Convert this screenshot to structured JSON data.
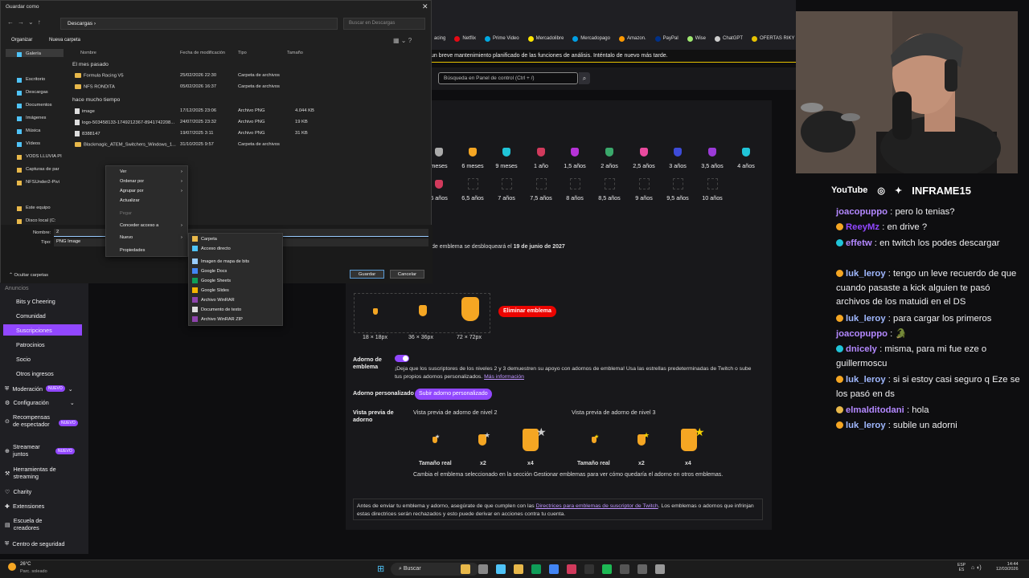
{
  "dialog": {
    "title": "Guardar como",
    "path": [
      "Descargas"
    ],
    "search_placeholder": "Buscar en Descargas",
    "organize": "Organizar",
    "new_folder": "Nueva carpeta",
    "nav_items": [
      "Galería",
      "Escritorio",
      "Descargas",
      "Documentos",
      "Imágenes",
      "Música",
      "Vídeos",
      "VODS LLUVIA PI",
      "Capturas de par",
      "NFSUnder2-Pivi",
      "Este equipo",
      "Disco local (C:"
    ],
    "columns": [
      "Nombre",
      "Fecha de modificación",
      "Tipo",
      "Tamaño"
    ],
    "groups": [
      {
        "label": "El mes pasado",
        "files": [
          {
            "name": "Formula Racing V5",
            "date": "25/02/2026 22:30",
            "type": "Carpeta de archivos",
            "size": "",
            "kind": "folder"
          },
          {
            "name": "NFS RONDITA",
            "date": "05/02/2026 16:37",
            "type": "Carpeta de archivos",
            "size": "",
            "kind": "folder"
          }
        ]
      },
      {
        "label": "hace mucho tiempo",
        "files": [
          {
            "name": "image",
            "date": "17/12/2025 23:06",
            "type": "Archivo PNG",
            "size": "4.044 KB",
            "kind": "file"
          },
          {
            "name": "logo-503458133-1749212367-8941742208...",
            "date": "24/07/2025 23:32",
            "type": "Archivo PNG",
            "size": "19 KB",
            "kind": "file"
          },
          {
            "name": "8388147",
            "date": "19/07/2025 3:11",
            "type": "Archivo PNG",
            "size": "31 KB",
            "kind": "file"
          },
          {
            "name": "Blackmagic_ATEM_Switchers_Windows_1...",
            "date": "31/10/2025 9:57",
            "type": "Carpeta de archivos",
            "size": "",
            "kind": "folder"
          }
        ]
      }
    ],
    "filename_label": "Nombre:",
    "filename_value": "2",
    "type_label": "Tipo:",
    "type_value": "PNG Image",
    "hide_folders": "Ocultar carpetas",
    "save": "Guardar",
    "cancel": "Cancelar"
  },
  "context_menu": [
    "Ver",
    "Ordenar por",
    "Agrupar por",
    "Actualizar",
    "Pegar",
    "Conceder acceso a",
    "Nuevo",
    "Propiedades"
  ],
  "submenu": [
    "Carpeta",
    "Acceso directo",
    "Imagen de mapa de bits",
    "Google Docs",
    "Google Sheets",
    "Google Slides",
    "Archivo WinRAR",
    "Documento de texto",
    "Archivo WinRAR ZIP"
  ],
  "bookmarks": [
    {
      "label": "acing",
      "color": "#888"
    },
    {
      "label": "Netflix",
      "color": "#e50914"
    },
    {
      "label": "Prime Video",
      "color": "#00a8e1"
    },
    {
      "label": "Mercadolibre",
      "color": "#ffe600"
    },
    {
      "label": "Mercadopago",
      "color": "#009ee3"
    },
    {
      "label": "Amazon.",
      "color": "#ff9900"
    },
    {
      "label": "PayPal",
      "color": "#003087"
    },
    {
      "label": "Wise",
      "color": "#9fe870"
    },
    {
      "label": "ChatGPT",
      "color": "#ccc"
    },
    {
      "label": "OFERTAS RIKY S",
      "color": "#e6c200"
    }
  ],
  "banner": "un breve mantenimiento planificado de las funciones de análisis. Inténtalo de nuevo más tarde.",
  "twitch_search_placeholder": "Búsqueda en Panel de control (Ctrl + /)",
  "sidebar": [
    "Anuncios",
    "Bits y Cheering",
    "Comunidad",
    "Suscripciones",
    "Patrocinios",
    "Socio",
    "Otros ingresos",
    "Moderación",
    "Configuración",
    "Recompensas de espectador",
    "Streamear juntos",
    "Herramientas de streaming",
    "Charity",
    "Extensiones",
    "Escuela de creadores",
    "Centro de seguridad"
  ],
  "sidebar_badge": "NUEVO",
  "months_row1": [
    "meses",
    "6 meses",
    "9 meses",
    "1 año",
    "1,5 años",
    "2 años",
    "2,5 años",
    "3 años",
    "3,5 años",
    "4 años"
  ],
  "months_row2": [
    "6 años",
    "6,5 años",
    "7 años",
    "7,5 años",
    "8 años",
    "8,5 años",
    "9 años",
    "9,5 años",
    "10 años"
  ],
  "mate_colors": [
    "#aaaaaa",
    "#f5a623",
    "#20c4d8",
    "#d13a5c",
    "#b633d8",
    "#3aa86b",
    "#e94a9e",
    "#3d4bd8",
    "#9b3ad8",
    "#20c4d8"
  ],
  "unlock_text_prefix": "de emblema se desbloqueará el",
  "unlock_date": "19 de junio de 2027",
  "sizes": [
    "18 × 18px",
    "36 × 36px",
    "72 × 72px"
  ],
  "delete_emblem": "Eliminar emblema",
  "adorno_label": "Adorno de emblema",
  "adorno_text": "¡Deja que los suscriptores de los niveles 2 y 3 demuestren su apoyo con adornos de emblema! Usa las estrellas predeterminadas de Twitch o sube tus propios adornos personalizados.",
  "more_info": "Más información",
  "custom_adorno_label": "Adorno personalizado",
  "upload_adorno": "Subir adorno personalizado",
  "preview_label": "Vista previa de adorno",
  "preview_t2": "Vista previa de adorno de nivel 2",
  "preview_t3": "Vista previa de adorno de nivel 3",
  "preview_sizes": [
    "Tamaño real",
    "x2",
    "x4"
  ],
  "preview_note": "Cambia el emblema seleccionado en la sección Gestionar emblemas para ver cómo quedaría el adorno en otros emblemas.",
  "guidelines_prefix": "Antes de enviar tu emblema y adorno, asegúrate de que cumplen con las",
  "guidelines_link": "Directrices para emblemas de suscriptor de Twitch",
  "guidelines_suffix": ". Los emblemas o adornos que infrinjan estas directrices serán rechazados y esto puede derivar en acciones contra tu cuenta.",
  "socials": {
    "youtube": "YouTube",
    "handle": "INFRAME15"
  },
  "chat": [
    {
      "user": "joacopuppo",
      "color": "#b388ff",
      "msg": "pero lo tenias?",
      "icon": ""
    },
    {
      "user": "ReeyMz",
      "color": "#9147ff",
      "msg": "en drive ?",
      "icon": "#f5a623"
    },
    {
      "user": "effetw",
      "color": "#b388ff",
      "msg": "en twitch los podes descargar",
      "icon": "#20c4d8"
    },
    {
      "user": "luk_leroy",
      "color": "#a0b8ff",
      "msg": "tengo un leve recuerdo de que cuando pasaste a kick alguien te pasó archivos de los matuidi en el DS",
      "icon": "#f5a623"
    },
    {
      "user": "luk_leroy",
      "color": "#a0b8ff",
      "msg": "para cargar los primeros",
      "icon": "#f5a623"
    },
    {
      "user": "joacopuppo",
      "color": "#b388ff",
      "msg": "🐊",
      "icon": ""
    },
    {
      "user": "dnicely",
      "color": "#b388ff",
      "msg": "misma, para mi fue eze o guillermoscu",
      "icon": "#20c4d8"
    },
    {
      "user": "luk_leroy",
      "color": "#a0b8ff",
      "msg": "si si estoy casi seguro q Eze se los pasó en ds",
      "icon": "#f5a623"
    },
    {
      "user": "elmalditodani",
      "color": "#b388ff",
      "msg": "hola",
      "icon": "#e8b84a"
    },
    {
      "user": "luk_leroy",
      "color": "#a0b8ff",
      "msg": "subile un adorni",
      "icon": "#f5a623"
    }
  ],
  "taskbar": {
    "weather_temp": "26°C",
    "weather_desc": "Parc. soleado",
    "search": "Buscar",
    "lang": "ESP",
    "region": "ES",
    "time": "14:44",
    "date": "12/03/2026"
  }
}
